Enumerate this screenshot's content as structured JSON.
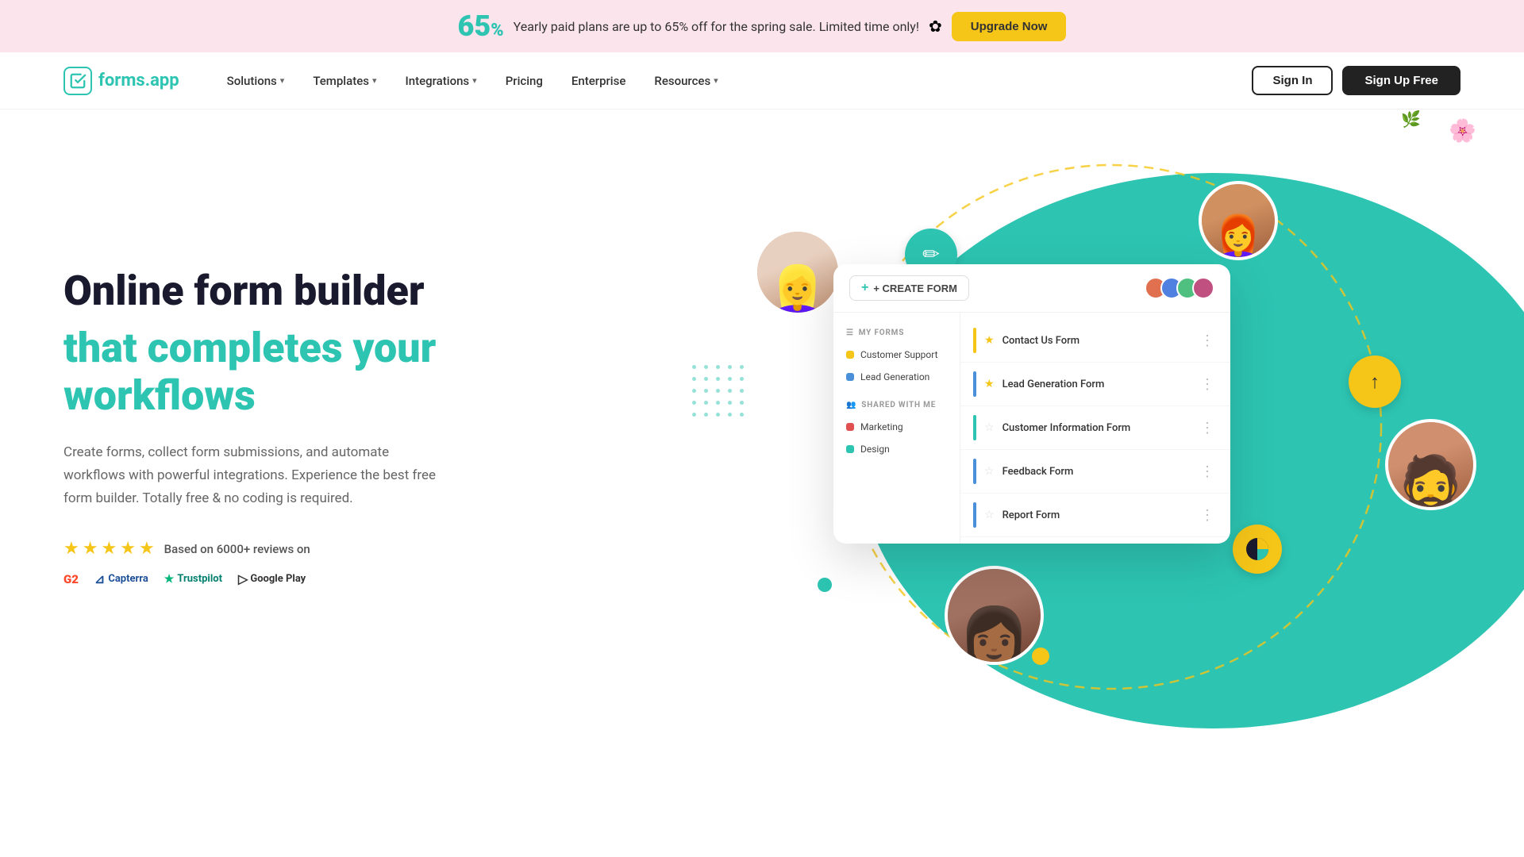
{
  "banner": {
    "percent": "65",
    "percent_sign": "%",
    "text": "Yearly paid plans are up to 65% off for the spring sale. Limited time only!",
    "snowflake": "✿",
    "upgrade_label": "Upgrade Now"
  },
  "nav": {
    "logo_text_1": "forms",
    "logo_text_2": ".app",
    "links": [
      {
        "label": "Solutions",
        "has_dropdown": true
      },
      {
        "label": "Templates",
        "has_dropdown": true
      },
      {
        "label": "Integrations",
        "has_dropdown": true
      },
      {
        "label": "Pricing",
        "has_dropdown": false
      },
      {
        "label": "Enterprise",
        "has_dropdown": false
      },
      {
        "label": "Resources",
        "has_dropdown": true
      }
    ],
    "signin_label": "Sign In",
    "signup_label": "Sign Up Free"
  },
  "hero": {
    "title_line1": "Online form builder",
    "title_line2": "that completes your workflows",
    "description": "Create forms, collect form submissions, and automate workflows with powerful integrations. Experience the best free form builder. Totally free & no coding is required.",
    "reviews_text": "Based on 6000+ reviews on",
    "stars": 5,
    "platforms": [
      "G2",
      "Capterra",
      "Trustpilot",
      "Google Play"
    ]
  },
  "app_window": {
    "create_form_label": "+ CREATE FORM",
    "my_forms_label": "MY FORMS",
    "shared_label": "SHARED WITH ME",
    "sidebar_items_my": [
      {
        "label": "Customer Support",
        "color": "yellow"
      },
      {
        "label": "Lead Generation",
        "color": "blue"
      }
    ],
    "sidebar_items_shared": [
      {
        "label": "Marketing",
        "color": "red"
      },
      {
        "label": "Design",
        "color": "blue"
      }
    ],
    "forms": [
      {
        "name": "Contact Us Form",
        "bar_color": "yellow",
        "starred": true
      },
      {
        "name": "Lead Generation Form",
        "bar_color": "blue",
        "starred": true
      },
      {
        "name": "Customer Information Form",
        "bar_color": "teal",
        "starred": false
      },
      {
        "name": "Feedback Form",
        "bar_color": "blue",
        "starred": false
      },
      {
        "name": "Report Form",
        "bar_color": "blue",
        "starred": false
      }
    ]
  },
  "icons": {
    "pencil": "✏",
    "share": "⬆",
    "chart": "◕",
    "chevron_down": "▾",
    "dots": "⋮",
    "form_icon": "☰"
  }
}
